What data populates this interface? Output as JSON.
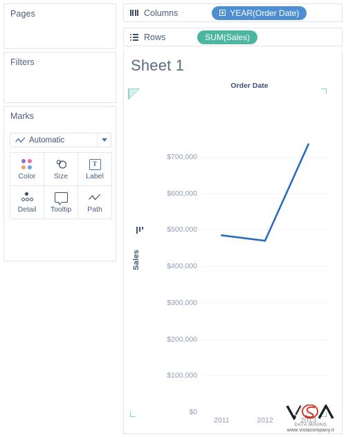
{
  "app": {
    "accent_blue": "#4e8fd1",
    "accent_green": "#4db6a0",
    "line_color": "#2b6cb8",
    "teal_marker": "#8fd4d1",
    "text_color": "#44546a"
  },
  "left_panel": {
    "pages": {
      "title": "Pages"
    },
    "filters": {
      "title": "Filters"
    },
    "marks": {
      "title": "Marks",
      "mark_type": {
        "value": "Automatic",
        "icon": "line-chart-icon",
        "caret": "chevron-down-icon"
      },
      "buttons": [
        {
          "label": "Color",
          "icon": "color-dots-icon"
        },
        {
          "label": "Size",
          "icon": "size-circles-icon"
        },
        {
          "label": "Label",
          "icon": "label-text-icon"
        },
        {
          "label": "Detail",
          "icon": "detail-dots-icon"
        },
        {
          "label": "Tooltip",
          "icon": "tooltip-bubble-icon"
        },
        {
          "label": "Path",
          "icon": "path-line-icon"
        }
      ],
      "color_dots": [
        "#8d6fd1",
        "#e5709f",
        "#f0a06a",
        "#6aa6e0"
      ]
    }
  },
  "shelves": {
    "columns": {
      "label": "Columns",
      "icon": "columns-icon",
      "pill": {
        "text": "YEAR(Order Date)",
        "icon": "expand-plus-icon",
        "color": "#4e8fd1"
      }
    },
    "rows": {
      "label": "Rows",
      "icon": "rows-icon",
      "pill": {
        "text": "SUM(Sales)",
        "color": "#4db6a0"
      }
    }
  },
  "viz": {
    "sheet_title": "Sheet 1",
    "column_header": "Order Date"
  },
  "watermark": {
    "brand": "VISTA",
    "subtitle": "DATA MINING",
    "url": "www.vistacompany.ir"
  },
  "chart_data": {
    "type": "line",
    "title": "Sheet 1",
    "xlabel": "Order Date",
    "ylabel": "Sales",
    "categories": [
      "2011",
      "2012",
      "2013"
    ],
    "x": [
      2011,
      2012,
      2013
    ],
    "values": [
      485000,
      470000,
      735000
    ],
    "series": [
      {
        "name": "SUM(Sales)",
        "values": [
          485000,
          470000,
          735000
        ],
        "color": "#2b6cb8"
      }
    ],
    "ylim": [
      0,
      735000
    ],
    "y_ticks": [
      0,
      100000,
      200000,
      300000,
      400000,
      500000,
      600000,
      700000
    ],
    "y_tick_labels": [
      "$0",
      "$100,000",
      "$200,000",
      "$300,000",
      "$400,000",
      "$500,000",
      "$600,000",
      "$700,000"
    ],
    "x_tick_labels": [
      "2011",
      "2012",
      "2013"
    ],
    "grid": true,
    "legend": "none"
  }
}
